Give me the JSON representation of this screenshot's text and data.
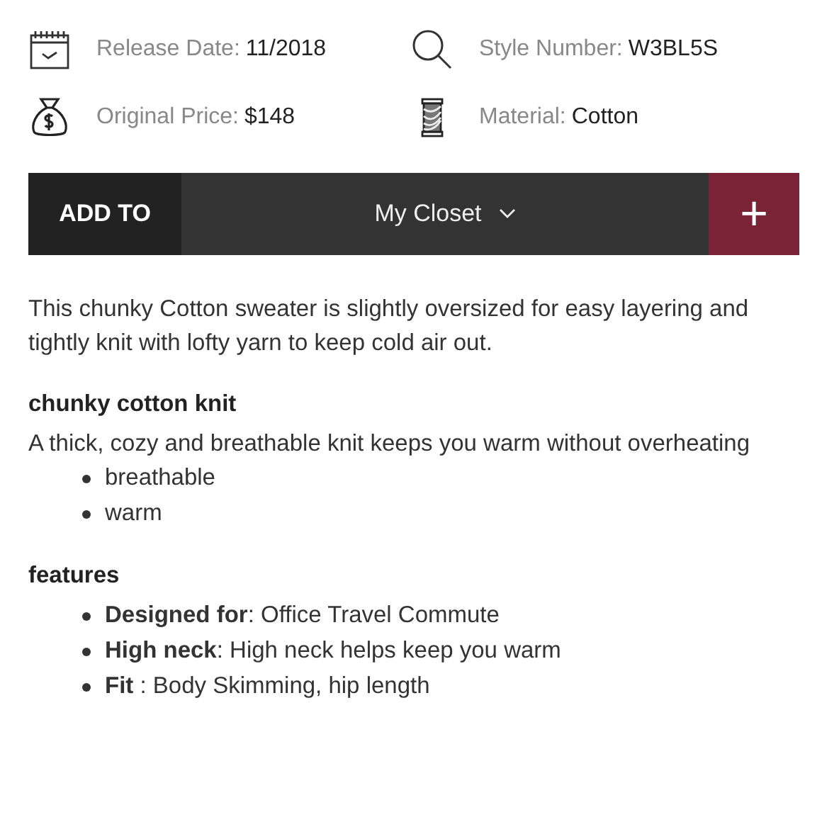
{
  "specs": [
    {
      "kind": "calendar",
      "label": "Release Date:",
      "value": "11/2018"
    },
    {
      "kind": "search",
      "label": "Style Number:",
      "value": "W3BL5S"
    },
    {
      "kind": "moneybag",
      "label": "Original Price:",
      "value": "$148"
    },
    {
      "kind": "spool",
      "label": "Material:",
      "value": "Cotton"
    }
  ],
  "add_bar": {
    "label": "ADD TO",
    "selection": "My Closet",
    "add": "+"
  },
  "description": "This chunky Cotton sweater is slightly oversized for easy layering and tightly knit with lofty yarn to keep cold air out.",
  "sections": [
    {
      "heading": "chunky cotton knit",
      "text": "A thick, cozy and breathable knit keeps you warm without overheating",
      "items": [
        "breathable",
        "warm"
      ]
    },
    {
      "heading": "features",
      "items": [
        "**Designed for**: Office Travel Commute",
        "**High neck**: High neck helps keep you warm",
        "**Fit** : Body Skimming, hip length"
      ]
    }
  ]
}
